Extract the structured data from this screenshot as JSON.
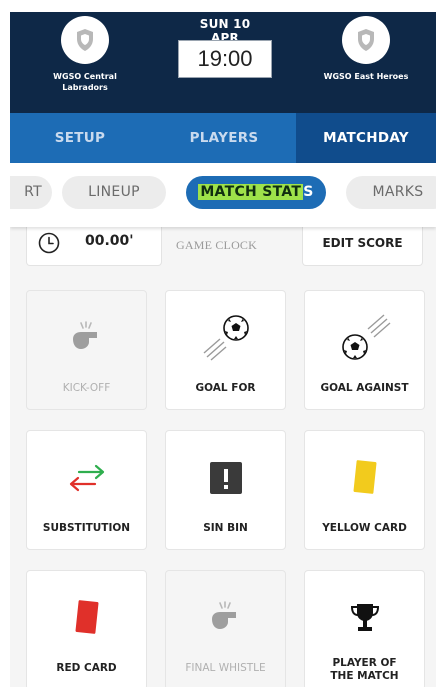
{
  "header": {
    "home_team": "WGSO Central\nLabradors",
    "away_team": "WGSO East Heroes",
    "date": "SUN 10 APR",
    "time": "19:00"
  },
  "nav_tabs": [
    {
      "label": "SETUP",
      "active": false
    },
    {
      "label": "PLAYERS",
      "active": false
    },
    {
      "label": "MATCHDAY",
      "active": true
    }
  ],
  "sub_tabs": [
    {
      "label": "RT",
      "active": false
    },
    {
      "label": "LINEUP",
      "active": false
    },
    {
      "label_highlighted": "MATCH STAT",
      "label_rest": "S",
      "active": true
    },
    {
      "label": "MARKS",
      "active": false
    }
  ],
  "game_clock": {
    "value": "00.00'",
    "label": "GAME CLOCK"
  },
  "edit_score": "EDIT SCORE",
  "actions": [
    {
      "label": "KICK-OFF",
      "icon": "whistle-icon",
      "enabled": false
    },
    {
      "label": "GOAL FOR",
      "icon": "ball-in-icon",
      "enabled": true
    },
    {
      "label": "GOAL AGAINST",
      "icon": "ball-out-icon",
      "enabled": true
    },
    {
      "label": "SUBSTITUTION",
      "icon": "swap-arrows-icon",
      "enabled": true
    },
    {
      "label": "SIN BIN",
      "icon": "exclamation-box-icon",
      "enabled": true
    },
    {
      "label": "YELLOW CARD",
      "icon": "yellow-card-icon",
      "enabled": true
    },
    {
      "label": "RED CARD",
      "icon": "red-card-icon",
      "enabled": true
    },
    {
      "label": "FINAL WHISTLE",
      "icon": "whistle-icon",
      "enabled": false
    },
    {
      "label": "PLAYER OF\nTHE MATCH",
      "icon": "trophy-icon",
      "enabled": true
    }
  ],
  "colors": {
    "header_bg": "#0e2847",
    "nav_bg": "#1d6cb5",
    "nav_active_bg": "#104c8c",
    "highlight": "#9ee24a",
    "yellow_card": "#f2cb1d",
    "red_card": "#e0302a",
    "sub_in": "#2fae4e",
    "sub_out": "#e0302a"
  }
}
